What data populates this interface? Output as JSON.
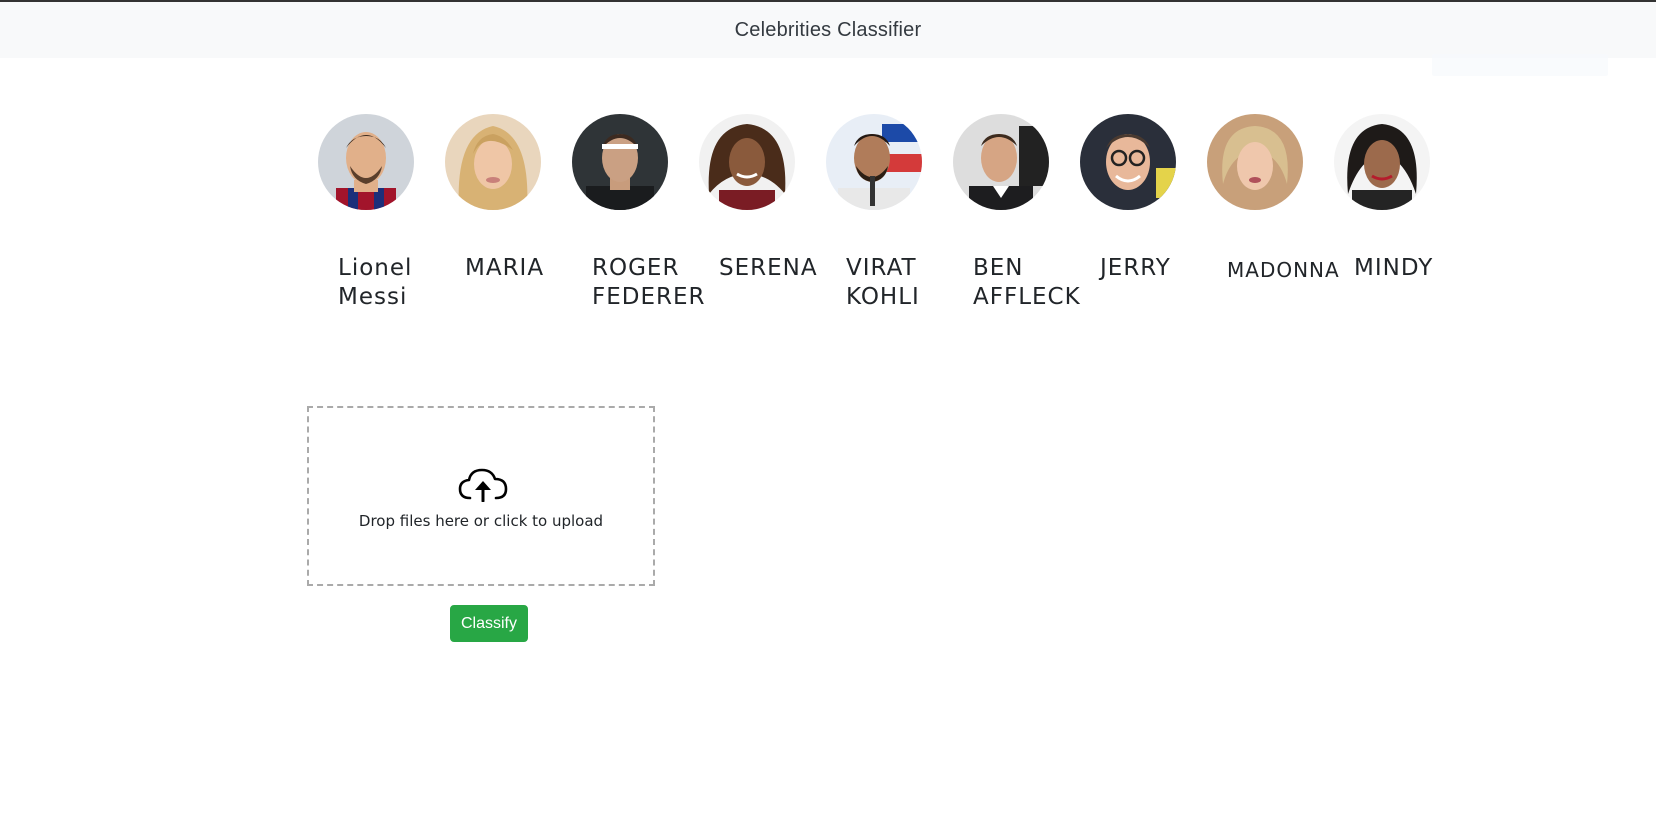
{
  "navbar": {
    "brand": "Celebrities Classifier"
  },
  "celebrities": [
    {
      "name": "Lionel Messi",
      "avatar_icon": "portrait-photo-icon"
    },
    {
      "name": "MARIA",
      "avatar_icon": "portrait-photo-icon"
    },
    {
      "name": "ROGER FEDERER",
      "avatar_icon": "portrait-photo-icon"
    },
    {
      "name": "SERENA",
      "avatar_icon": "portrait-photo-icon"
    },
    {
      "name": "VIRAT KOHLI",
      "avatar_icon": "portrait-photo-icon"
    },
    {
      "name": "BEN AFFLECK",
      "avatar_icon": "portrait-photo-icon"
    },
    {
      "name": "JERRY",
      "avatar_icon": "portrait-photo-icon"
    },
    {
      "name": "MADONNA",
      "avatar_icon": "portrait-photo-icon"
    },
    {
      "name": "MINDY",
      "avatar_icon": "portrait-photo-icon"
    }
  ],
  "dropzone": {
    "message": "Drop files here or click to upload",
    "icon": "cloud-upload-icon"
  },
  "actions": {
    "classify_label": "Classify"
  },
  "colors": {
    "navbar_bg": "#f8f9fa",
    "button_green": "#28a745",
    "dropzone_border": "#aaaaaa"
  }
}
